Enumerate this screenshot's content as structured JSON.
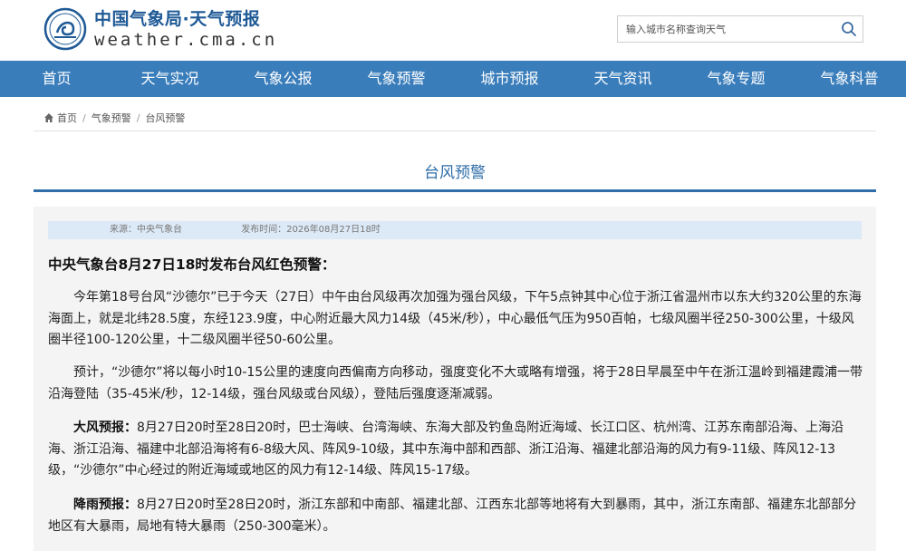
{
  "header": {
    "brand_cn": "中国气象局·天气预报",
    "brand_en": "weather.cma.cn",
    "search_placeholder": "输入城市名称查询天气"
  },
  "icons": {
    "logo": "cma-logo-icon",
    "search": "search-icon",
    "home": "home-icon"
  },
  "colors": {
    "nav_bg": "#3a7dbb",
    "title_blue": "#2f6ea8",
    "brand_blue": "#1f5a96",
    "meta_bg": "#dce9f6"
  },
  "nav": [
    "首页",
    "天气实况",
    "气象公报",
    "气象预警",
    "城市预报",
    "天气资讯",
    "气象专题",
    "气象科普"
  ],
  "breadcrumb": [
    "首页",
    "气象预警",
    "台风预警"
  ],
  "page_title": "台风预警",
  "meta": {
    "source": "来源：中央气象台",
    "time": "发布时间：2026年08月27日18时"
  },
  "article": {
    "headline": "中央气象台8月27日18时发布台风红色预警：",
    "p1": "今年第18号台风“沙德尔”已于今天（27日）中午由台风级再次加强为强台风级，下午5点钟其中心位于浙江省温州市以东大约320公里的东海海面上，就是北纬28.5度，东经123.9度，中心附近最大风力14级（45米/秒），中心最低气压为950百帕，七级风圈半径250-300公里，十级风圈半径100-120公里，十二级风圈半径50-60公里。",
    "p2": "预计，“沙德尔”将以每小时10-15公里的速度向西偏南方向移动，强度变化不大或略有增强，将于28日早晨至中午在浙江温岭到福建霞浦一带沿海登陆（35-45米/秒，12-14级，强台风级或台风级），登陆后强度逐渐减弱。",
    "p3_label": "大风预报：",
    "p3": "8月27日20时至28日20时，巴士海峡、台湾海峡、东海大部及钓鱼岛附近海域、长江口区、杭州湾、江苏东南部沿海、上海沿海、浙江沿海、福建中北部沿海将有6-8级大风、阵风9-10级，其中东海中部和西部、浙江沿海、福建北部沿海的风力有9-11级、阵风12-13级，“沙德尔”中心经过的附近海域或地区的风力有12-14级、阵风15-17级。",
    "p4_label": "降雨预报：",
    "p4": "8月27日20时至28日20时，浙江东部和中南部、福建北部、江西东北部等地将有大到暴雨，其中，浙江东南部、福建东北部部分地区有大暴雨，局地有特大暴雨（250-300毫米）。"
  }
}
